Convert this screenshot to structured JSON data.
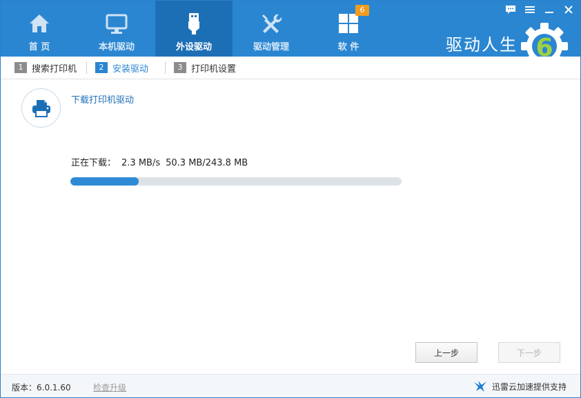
{
  "nav": {
    "items": [
      {
        "label": "首 页",
        "icon": "home-icon"
      },
      {
        "label": "本机驱动",
        "icon": "monitor-icon"
      },
      {
        "label": "外设驱动",
        "icon": "usb-icon"
      },
      {
        "label": "驱动管理",
        "icon": "tools-icon"
      },
      {
        "label": "软 件",
        "icon": "apps-grid-icon",
        "badge": "6"
      }
    ],
    "active_index": 2
  },
  "brand": {
    "name": "驱动人生",
    "logo_digit": "6"
  },
  "window_controls": [
    "feedback-icon",
    "menu-icon",
    "minimize-icon",
    "close-icon"
  ],
  "steps": [
    {
      "num": "1",
      "label": "搜索打印机"
    },
    {
      "num": "2",
      "label": "安装驱动"
    },
    {
      "num": "3",
      "label": "打印机设置"
    }
  ],
  "active_step": 1,
  "download": {
    "title": "下载打印机驱动",
    "status_label": "正在下载：",
    "speed": "2.3 MB/s",
    "progress_text": "50.3 MB/243.8 MB",
    "progress_fraction": 0.206
  },
  "buttons": {
    "prev": "上一步",
    "next": "下一步"
  },
  "footer": {
    "version": "版本：6.0.1.60",
    "check_update": "检查升级",
    "xunlei": "迅雷云加速提供支持"
  },
  "colors": {
    "header": "#2b86d1",
    "active_tab": "#1d6fb5",
    "accent": "#2a86d1",
    "badge": "#f39c1f"
  }
}
